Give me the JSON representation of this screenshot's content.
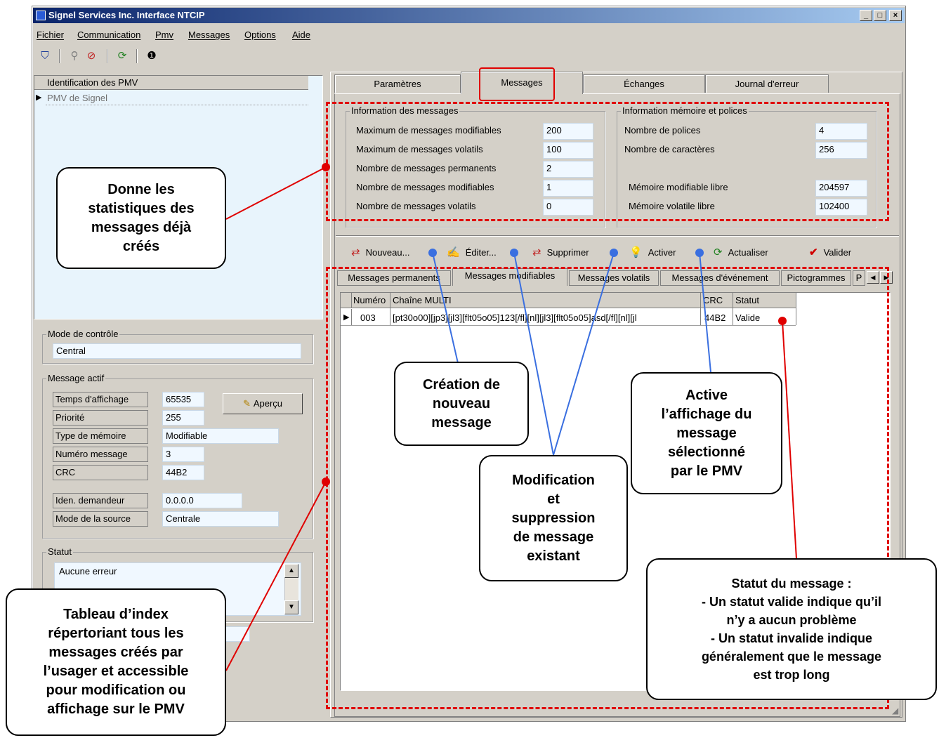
{
  "window": {
    "title": "Signel Services Inc. Interface NTCIP",
    "min": "_",
    "max": "□",
    "close": "×"
  },
  "menu": [
    "Fichier",
    "Communication",
    "Pmv",
    "Messages",
    "Options",
    "Aide"
  ],
  "left": {
    "list_header": "Identification des PMV",
    "list_item": "PMV de Signel",
    "mode": {
      "label": "Mode de contrôle",
      "value": "Central"
    },
    "active": {
      "label": "Message actif",
      "preview": "Aperçu",
      "rows": [
        {
          "k": "Temps d'affichage",
          "v": "65535"
        },
        {
          "k": "Priorité",
          "v": "255"
        },
        {
          "k": "Type de mémoire",
          "v": "Modifiable"
        },
        {
          "k": "Numéro message",
          "v": "3"
        },
        {
          "k": "CRC",
          "v": "44B2"
        },
        {
          "k": "Iden. demandeur",
          "v": "0.0.0.0"
        },
        {
          "k": "Mode de la source",
          "v": "Centrale"
        }
      ]
    },
    "status": {
      "label": "Statut",
      "value": "Aucune erreur"
    }
  },
  "tabs": [
    "Paramètres",
    "Messages",
    "Échanges",
    "Journal d'erreur"
  ],
  "info_messages": {
    "label": "Information des messages",
    "rows": [
      {
        "k": "Maximum de messages modifiables",
        "v": "200"
      },
      {
        "k": "Maximum de messages volatils",
        "v": "100"
      },
      {
        "k": "Nombre de messages permanents",
        "v": "2"
      },
      {
        "k": "Nombre de messages modifiables",
        "v": "1"
      },
      {
        "k": "Nombre de messages volatils",
        "v": "0"
      }
    ]
  },
  "info_memory": {
    "label": "Information mémoire et polices",
    "rows": [
      {
        "k": "Nombre de polices",
        "v": "4"
      },
      {
        "k": "Nombre de caractères",
        "v": "256"
      },
      {
        "k": "Mémoire modifiable libre",
        "v": "204597"
      },
      {
        "k": "Mémoire volatile libre",
        "v": "102400"
      }
    ]
  },
  "actions": [
    "Nouveau...",
    "Éditer...",
    "Supprimer",
    "Activer",
    "Actualiser",
    "Valider"
  ],
  "subtabs": [
    "Messages permanents",
    "Messages modifiables",
    "Messages volatils",
    "Messages d'événement",
    "Pictogrammes",
    "P"
  ],
  "grid": {
    "headers": [
      "Numéro",
      "Chaîne MULTI",
      "CRC",
      "Statut"
    ],
    "rows": [
      {
        "num": "003",
        "multi": "[pt30o00][jp3][jl3][flt05o05]123[/fl][nl][jl3][flt05o05]asd[/fl][nl][jl",
        "crc": "44B2",
        "status": "Valide"
      }
    ]
  },
  "callouts": {
    "stats": [
      "Donne les",
      "statistiques des",
      "messages déjà",
      "créés"
    ],
    "index": [
      "Tableau d’index",
      "répertoriant tous les",
      "messages créés par",
      "l’usager et accessible",
      "pour modification ou",
      "affichage sur le PMV"
    ],
    "new": [
      "Création de",
      "nouveau",
      "message"
    ],
    "modif": [
      "Modification",
      "et",
      "suppression",
      "de message",
      "existant"
    ],
    "activate": [
      "Active",
      "l’affichage du",
      "message",
      "sélectionné",
      "par le PMV"
    ],
    "status": [
      "Statut du message :",
      "- Un statut valide indique qu’il",
      "n’y a aucun problème",
      "- Un statut invalide indique",
      "généralement que le message",
      "est trop long"
    ]
  },
  "colors": {
    "annotation_red": "#e00000",
    "annotation_blue": "#3a6fe0",
    "titlebar": "#0a246a"
  }
}
